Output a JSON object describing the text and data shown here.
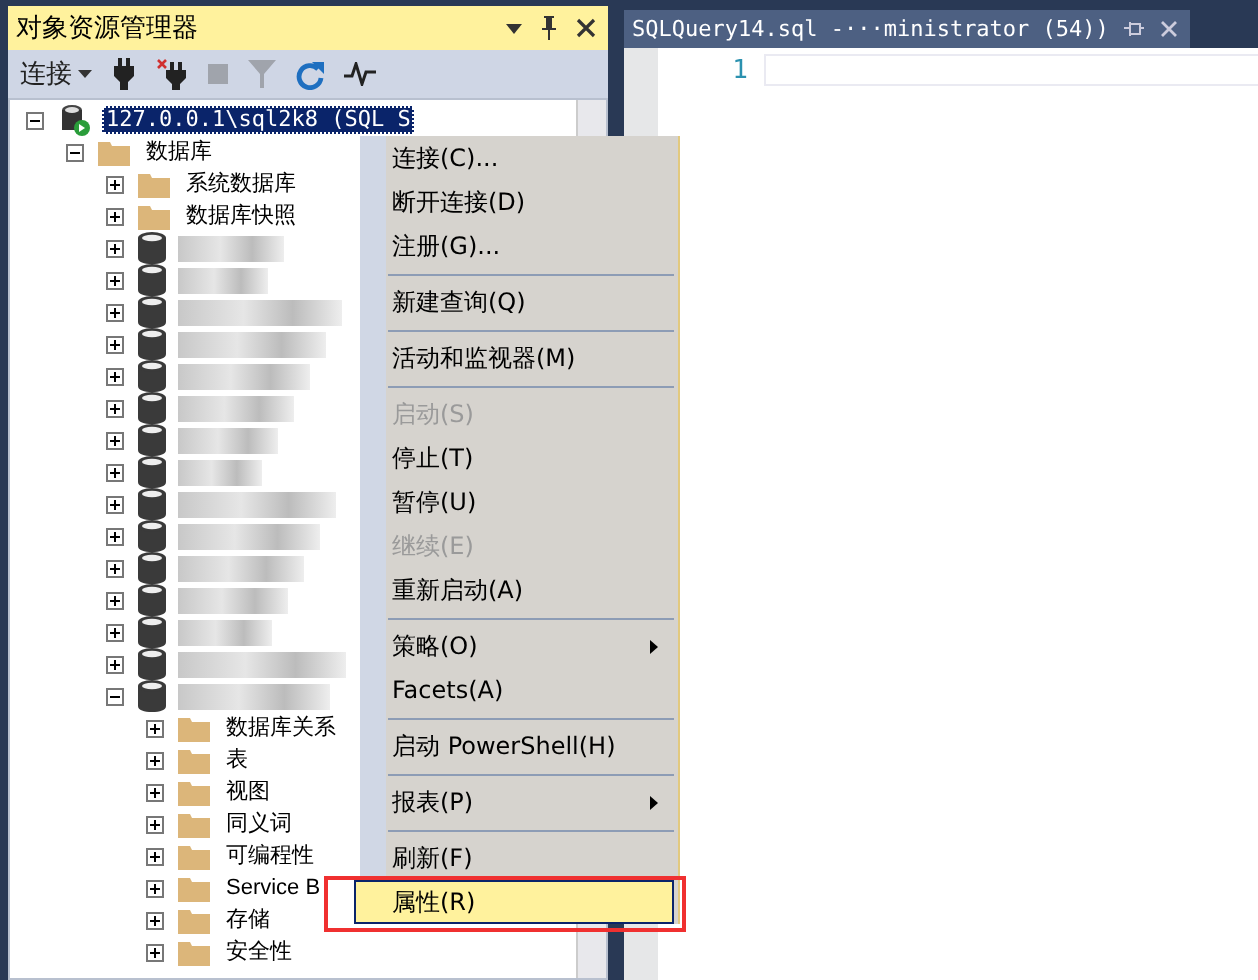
{
  "explorer": {
    "title": "对象资源管理器",
    "toolbar": {
      "connect_label": "连接"
    }
  },
  "tree": [
    {
      "kind": "server",
      "label": "127.0.0.1\\sql2k8 (SQL S",
      "expanded": true,
      "selected": true,
      "children": [
        {
          "kind": "folder",
          "label": "数据库",
          "expanded": true,
          "selected": false,
          "children": [
            {
              "kind": "folder",
              "label": "系统数据库",
              "expanded": false,
              "selected": false
            },
            {
              "kind": "folder",
              "label": "数据库快照",
              "expanded": false,
              "selected": false
            },
            {
              "kind": "database",
              "expanded": false,
              "selected": false
            },
            {
              "kind": "database",
              "expanded": false,
              "selected": false
            },
            {
              "kind": "database",
              "expanded": false,
              "selected": false
            },
            {
              "kind": "database",
              "expanded": false,
              "selected": false
            },
            {
              "kind": "database",
              "expanded": false,
              "selected": false
            },
            {
              "kind": "database",
              "expanded": false,
              "selected": false
            },
            {
              "kind": "database",
              "expanded": false,
              "selected": false
            },
            {
              "kind": "database",
              "expanded": false,
              "selected": false
            },
            {
              "kind": "database",
              "expanded": false,
              "selected": false
            },
            {
              "kind": "database",
              "expanded": false,
              "selected": false
            },
            {
              "kind": "database",
              "expanded": false,
              "selected": false
            },
            {
              "kind": "database",
              "expanded": false,
              "selected": false
            },
            {
              "kind": "database",
              "expanded": false,
              "selected": false
            },
            {
              "kind": "database",
              "expanded": false,
              "selected": false
            },
            {
              "kind": "database",
              "expanded": true,
              "selected": false,
              "children": [
                {
                  "kind": "folder",
                  "label": "数据库关系",
                  "expanded": false,
                  "selected": false
                },
                {
                  "kind": "folder",
                  "label": "表",
                  "expanded": false,
                  "selected": false
                },
                {
                  "kind": "folder",
                  "label": "视图",
                  "expanded": false,
                  "selected": false
                },
                {
                  "kind": "folder",
                  "label": "同义词",
                  "expanded": false,
                  "selected": false
                },
                {
                  "kind": "folder",
                  "label": "可编程性",
                  "expanded": false,
                  "selected": false
                },
                {
                  "kind": "folder",
                  "label": "Service B",
                  "expanded": false,
                  "selected": false
                },
                {
                  "kind": "folder",
                  "label": "存储",
                  "expanded": false,
                  "selected": false
                },
                {
                  "kind": "folder",
                  "label": "安全性",
                  "expanded": false,
                  "selected": false
                }
              ]
            }
          ]
        }
      ]
    }
  ],
  "editor": {
    "tab": {
      "title": "SQLQuery14.sql -···ministrator (54))"
    },
    "line_numbers": [
      "1"
    ]
  },
  "context_menu": [
    {
      "kind": "item",
      "label": "连接(C)...",
      "disabled": false,
      "submenu": false,
      "selected": false
    },
    {
      "kind": "item",
      "label": "断开连接(D)",
      "disabled": false,
      "submenu": false,
      "selected": false
    },
    {
      "kind": "item",
      "label": "注册(G)...",
      "disabled": false,
      "submenu": false,
      "selected": false
    },
    {
      "kind": "separator"
    },
    {
      "kind": "item",
      "label": "新建查询(Q)",
      "disabled": false,
      "submenu": false,
      "selected": false
    },
    {
      "kind": "separator"
    },
    {
      "kind": "item",
      "label": "活动和监视器(M)",
      "disabled": false,
      "submenu": false,
      "selected": false
    },
    {
      "kind": "separator"
    },
    {
      "kind": "item",
      "label": "启动(S)",
      "disabled": true,
      "submenu": false,
      "selected": false
    },
    {
      "kind": "item",
      "label": "停止(T)",
      "disabled": false,
      "submenu": false,
      "selected": false
    },
    {
      "kind": "item",
      "label": "暂停(U)",
      "disabled": false,
      "submenu": false,
      "selected": false
    },
    {
      "kind": "item",
      "label": "继续(E)",
      "disabled": true,
      "submenu": false,
      "selected": false
    },
    {
      "kind": "item",
      "label": "重新启动(A)",
      "disabled": false,
      "submenu": false,
      "selected": false
    },
    {
      "kind": "separator"
    },
    {
      "kind": "item",
      "label": "策略(O)",
      "disabled": false,
      "submenu": true,
      "selected": false
    },
    {
      "kind": "item",
      "label": "Facets(A)",
      "disabled": false,
      "submenu": false,
      "selected": false
    },
    {
      "kind": "separator"
    },
    {
      "kind": "item",
      "label": "启动 PowerShell(H)",
      "disabled": false,
      "submenu": false,
      "selected": false
    },
    {
      "kind": "separator"
    },
    {
      "kind": "item",
      "label": "报表(P)",
      "disabled": false,
      "submenu": true,
      "selected": false
    },
    {
      "kind": "separator"
    },
    {
      "kind": "item",
      "label": "刷新(F)",
      "disabled": false,
      "submenu": false,
      "selected": false
    },
    {
      "kind": "item",
      "label": "属性(R)",
      "disabled": false,
      "submenu": false,
      "selected": true
    }
  ]
}
